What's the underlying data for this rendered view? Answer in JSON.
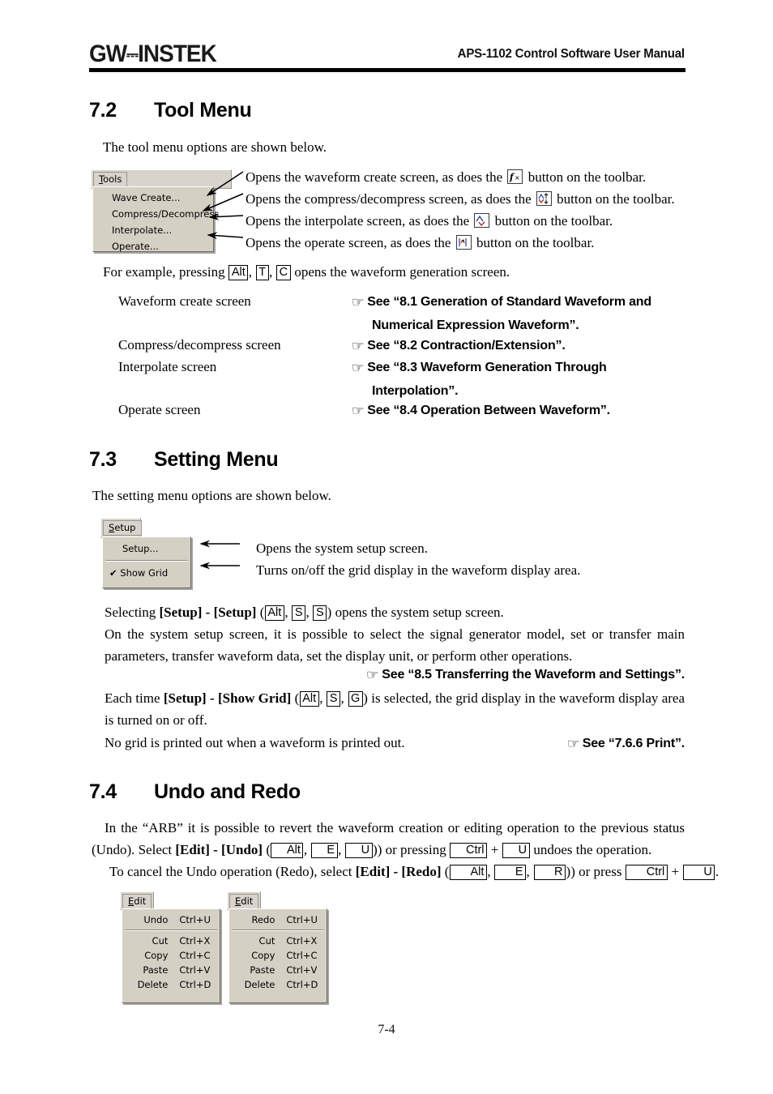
{
  "header": {
    "logo_main": "INSTEK",
    "logo_prefix": "GW",
    "title": "APS-1102 Control Software User Manual"
  },
  "sections": {
    "tool_menu": {
      "number": "7.2",
      "title": "Tool Menu",
      "intro": "The tool menu options are shown below.",
      "menu": {
        "bar_label": "Tools",
        "bar_label_accel": "T",
        "items": [
          {
            "label": "Wave Create..."
          },
          {
            "label": "Compress/Decompress"
          },
          {
            "label": "Interpolate..."
          },
          {
            "label": "Operate..."
          }
        ]
      },
      "callouts": [
        {
          "text_before": "Opens the waveform create screen, as does the ",
          "icon": "fx-button-icon",
          "text_after": " button on the toolbar."
        },
        {
          "text_before": "Opens the compress/decompress screen, as does the ",
          "icon": "compress-decompress-button-icon",
          "text_after": " button on the toolbar."
        },
        {
          "text_before": "Opens the interpolate screen, as does the ",
          "icon": "interpolate-button-icon",
          "text_after": " button on the toolbar."
        },
        {
          "text_before": "Opens the operate screen, as does the ",
          "icon": "operate-button-icon",
          "text_after": " button on the toolbar."
        }
      ],
      "example_prefix": "For example, pressing ",
      "example_keys": [
        "Alt",
        "T",
        "C"
      ],
      "example_suffix": " opens the waveform generation screen.",
      "references": [
        {
          "screen": "Waveform create screen",
          "see": "See “8.1 Generation of Standard Waveform and",
          "see_line2": "Numerical Expression Waveform”."
        },
        {
          "screen": "Compress/decompress screen",
          "see": "See “8.2 Contraction/Extension”.",
          "see_line2": ""
        },
        {
          "screen": "Interpolate screen",
          "see": "See “8.3 Waveform Generation Through",
          "see_line2": "Interpolation”."
        },
        {
          "screen": "Operate screen",
          "see": "See “8.4 Operation Between Waveform”.",
          "see_line2": ""
        }
      ]
    },
    "setting_menu": {
      "number": "7.3",
      "title": "Setting Menu",
      "intro": "The setting menu options are shown below.",
      "menu": {
        "bar_label": "Setup",
        "bar_label_accel": "S",
        "items": [
          {
            "label": "Setup...",
            "check": ""
          },
          {
            "label": "Show Grid",
            "check": "✔"
          }
        ]
      },
      "callouts": [
        "Opens the system setup screen.",
        "Turns on/off the grid display in the waveform display area."
      ],
      "para1_a": "Selecting ",
      "para1_b": "[Setup] - [Setup]",
      "para1_keys": [
        "Alt",
        "S",
        "S"
      ],
      "para1_c": ") opens the system setup screen.",
      "para2": "On the system setup screen, it is possible to select the signal generator model, set or transfer main parameters, transfer waveform data, set the display unit, or perform other operations.",
      "see_transfer": "See “8.5 Transferring the Waveform and Settings”.",
      "para3_a": "Each time ",
      "para3_b": "[Setup] - [Show Grid]",
      "para3_keys": [
        "Alt",
        "S",
        "G"
      ],
      "para3_c": ") is selected, the grid display in the waveform display area is turned on or off.",
      "para4": "No grid is printed out when a waveform is printed out.",
      "see_print": "See “7.6.6 Print”."
    },
    "undo_redo": {
      "number": "7.4",
      "title": "Undo and Redo",
      "para1_a": "In the “ARB” it is possible to revert the waveform creation or editing operation to the previous status (Undo). Select ",
      "para1_b": "[Edit] - [Undo]",
      "para1_keys": [
        "Alt",
        "E",
        "U"
      ],
      "para1_c": ") or pressing ",
      "para1_keys2": [
        "Ctrl",
        "U"
      ],
      "para1_d": " undoes the operation.",
      "para2_a": "To cancel the Undo operation (Redo), select ",
      "para2_b": "[Edit] - [Redo]",
      "para2_keys": [
        "Alt",
        "E",
        "R"
      ],
      "para2_c": ") or press ",
      "para2_keys2": [
        "Ctrl",
        "U"
      ],
      "para2_d": ".",
      "edit_menu_undo": {
        "bar_label": "Edit",
        "bar_label_accel": "E",
        "items": [
          {
            "label": "Undo",
            "shortcut": "Ctrl+U"
          },
          {
            "label": "Cut",
            "shortcut": "Ctrl+X"
          },
          {
            "label": "Copy",
            "shortcut": "Ctrl+C"
          },
          {
            "label": "Paste",
            "shortcut": "Ctrl+V"
          },
          {
            "label": "Delete",
            "shortcut": "Ctrl+D"
          }
        ]
      },
      "edit_menu_redo": {
        "bar_label": "Edit",
        "bar_label_accel": "E",
        "items": [
          {
            "label": "Redo",
            "shortcut": "Ctrl+U"
          },
          {
            "label": "Cut",
            "shortcut": "Ctrl+X"
          },
          {
            "label": "Copy",
            "shortcut": "Ctrl+C"
          },
          {
            "label": "Paste",
            "shortcut": "Ctrl+V"
          },
          {
            "label": "Delete",
            "shortcut": "Ctrl+D"
          }
        ]
      }
    }
  },
  "footer": {
    "page_number": "7-4"
  },
  "colors": {
    "menu_face": "#d4d0c4",
    "menubar_face": "#d8d4cc",
    "rule": "#000000"
  }
}
